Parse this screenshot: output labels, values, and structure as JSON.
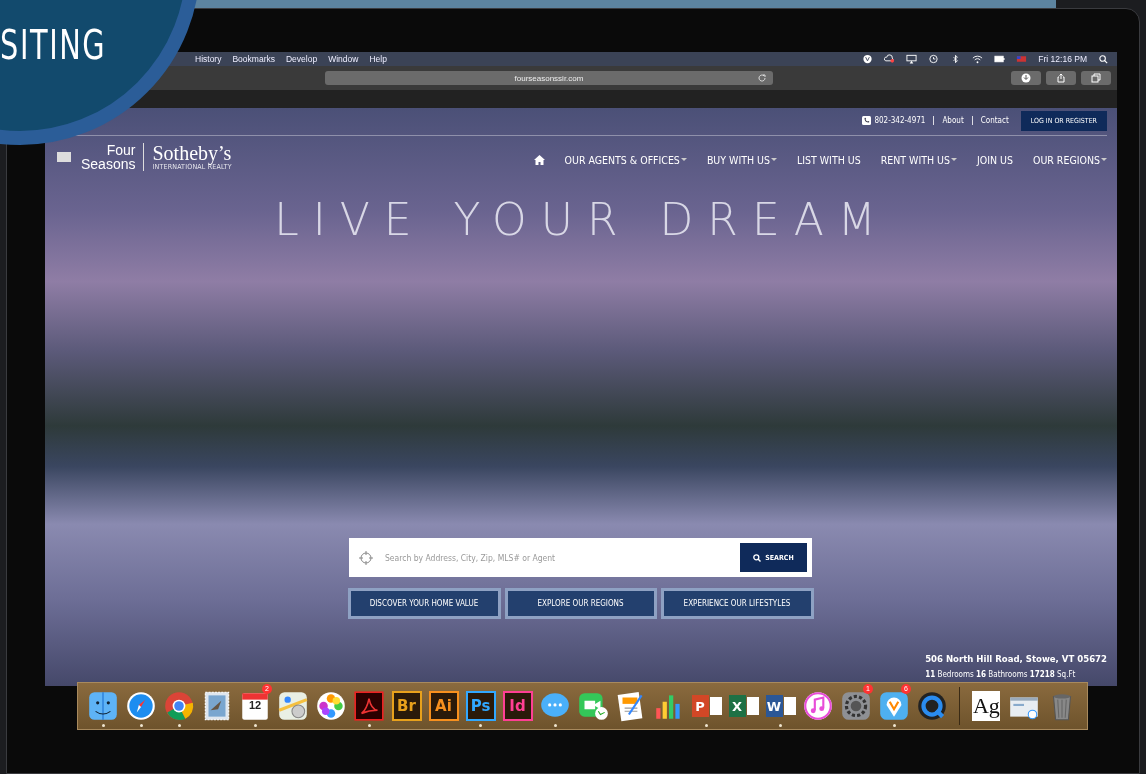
{
  "badge": {
    "text": "SITING"
  },
  "menubar": {
    "menus": [
      "History",
      "Bookmarks",
      "Develop",
      "Window",
      "Help"
    ],
    "clock": "Fri 12:16 PM"
  },
  "browser": {
    "address": "fourseasonssir.com"
  },
  "site": {
    "phone": "802-342-4971",
    "links": [
      "About",
      "Contact"
    ],
    "login": "LOG IN OR REGISTER",
    "logo": {
      "line1": "Four",
      "line2": "Seasons",
      "brand": "Sotheby’s",
      "tagline": "INTERNATIONAL REALTY"
    },
    "nav": [
      {
        "label": "OUR AGENTS & OFFICES",
        "dropdown": true
      },
      {
        "label": "BUY WITH US",
        "dropdown": true
      },
      {
        "label": "LIST WITH US",
        "dropdown": false
      },
      {
        "label": "RENT WITH US",
        "dropdown": true
      },
      {
        "label": "JOIN US",
        "dropdown": false
      },
      {
        "label": "OUR REGIONS",
        "dropdown": true
      }
    ],
    "headline": "LIVE YOUR DREAM",
    "search": {
      "placeholder": "Search by Address, City, Zip, MLS# or Agent",
      "button": "SEARCH"
    },
    "actions": [
      "DISCOVER YOUR HOME VALUE",
      "EXPLORE OUR REGIONS",
      "EXPERIENCE OUR LIFESTYLES"
    ],
    "listing": {
      "address": "506 North Hill Road, Stowe, VT 05672",
      "details": "**11** Bedrooms **16** Bathrooms **17218** Sq.Ft"
    }
  },
  "dock": [
    {
      "kind": "finder",
      "running": true
    },
    {
      "kind": "compass",
      "running": true
    },
    {
      "kind": "chrome",
      "running": true
    },
    {
      "kind": "stamp",
      "running": false
    },
    {
      "kind": "calendar",
      "label": "12",
      "badge": "2",
      "running": true
    },
    {
      "kind": "map",
      "running": false
    },
    {
      "kind": "flower",
      "running": false
    },
    {
      "kind": "acrobat",
      "running": true
    },
    {
      "kind": "tile",
      "label": "Br",
      "color": "#e8a11c",
      "running": false
    },
    {
      "kind": "tile",
      "label": "Ai",
      "color": "#f7901e",
      "running": false
    },
    {
      "kind": "tile",
      "label": "Ps",
      "color": "#31a8ff",
      "running": true
    },
    {
      "kind": "tile",
      "label": "Id",
      "color": "#ff3f94",
      "running": false
    },
    {
      "kind": "chat",
      "running": true
    },
    {
      "kind": "video",
      "running": false
    },
    {
      "kind": "pages",
      "running": false
    },
    {
      "kind": "chart",
      "running": false
    },
    {
      "kind": "doc",
      "label": "P",
      "color": "#d24726",
      "running": true
    },
    {
      "kind": "doc",
      "label": "X",
      "color": "#1e7145",
      "running": false
    },
    {
      "kind": "doc",
      "label": "W",
      "color": "#2b5797",
      "running": true
    },
    {
      "kind": "music",
      "running": false
    },
    {
      "kind": "gear",
      "badge": "1",
      "running": false
    },
    {
      "kind": "pin",
      "badge": "6",
      "running": true
    },
    {
      "kind": "q",
      "running": false
    },
    {
      "kind": "separator"
    },
    {
      "kind": "font",
      "label": "Ag",
      "running": false
    },
    {
      "kind": "window",
      "running": false
    },
    {
      "kind": "trash",
      "running": false
    }
  ]
}
